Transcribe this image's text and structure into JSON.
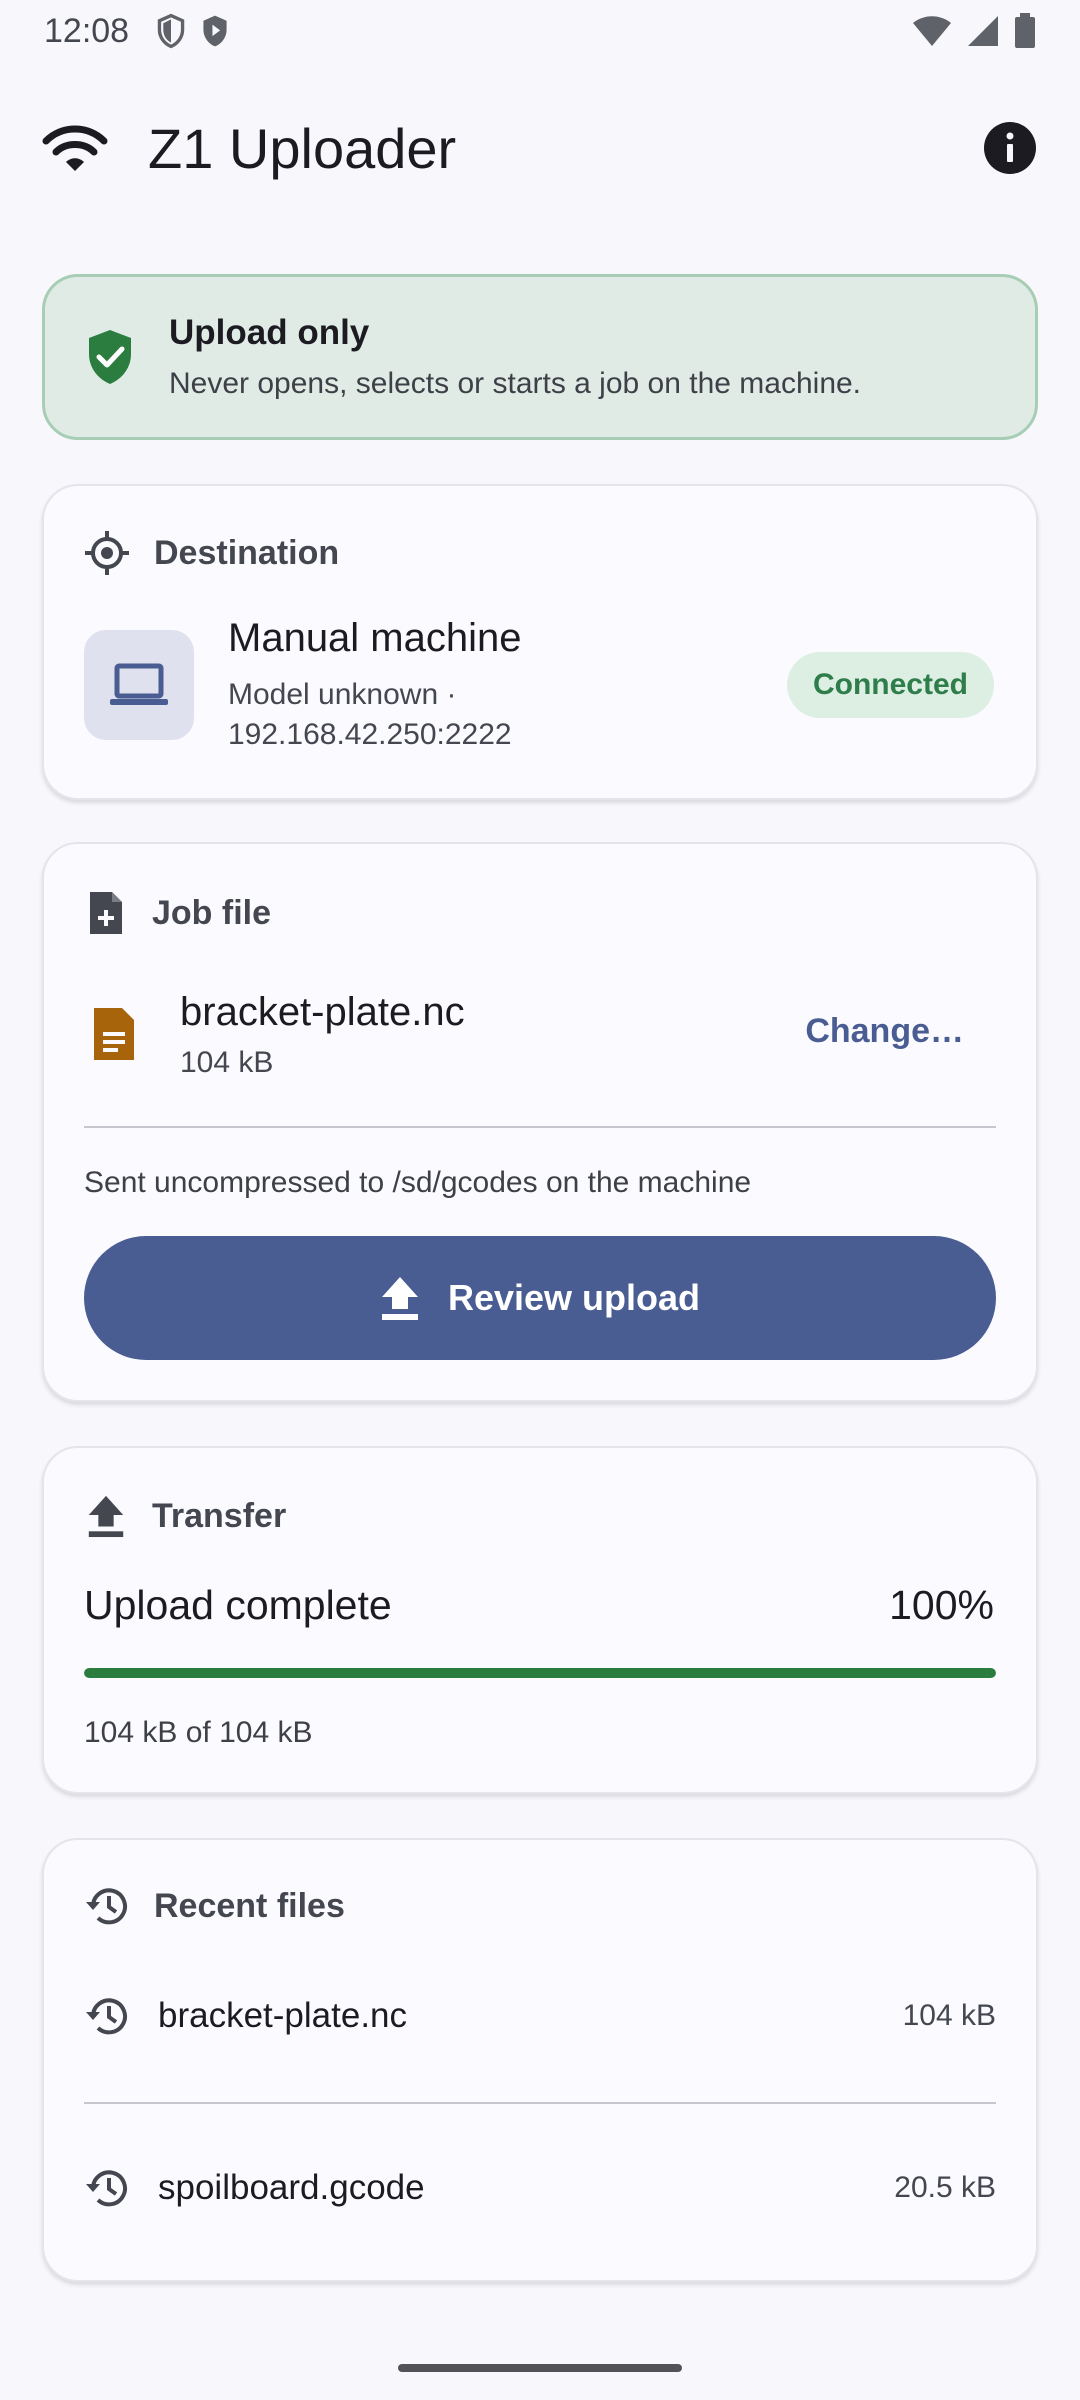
{
  "status_bar": {
    "time": "12:08"
  },
  "app_bar": {
    "title": "Z1 Uploader"
  },
  "banner": {
    "title": "Upload only",
    "subtitle": "Never opens, selects or starts a job on the machine."
  },
  "destination": {
    "header": "Destination",
    "machine_name": "Manual machine",
    "machine_detail_line1": "Model unknown ·",
    "machine_detail_line2": "192.168.42.250:2222",
    "status": "Connected"
  },
  "job_file": {
    "header": "Job file",
    "file_name": "bracket-plate.nc",
    "file_size": "104 kB",
    "change_label": "Change…",
    "note": "Sent uncompressed to /sd/gcodes on the machine",
    "review_button": "Review upload"
  },
  "transfer": {
    "header": "Transfer",
    "status": "Upload complete",
    "percent_label": "100%",
    "progress_fraction": 1.0,
    "bytes_label": "104 kB of 104 kB"
  },
  "recent_files": {
    "header": "Recent files",
    "items": [
      {
        "name": "bracket-plate.nc",
        "size": "104 kB"
      },
      {
        "name": "spoilboard.gcode",
        "size": "20.5 kB"
      }
    ]
  },
  "colors": {
    "accent": "#4a5d92",
    "success": "#2a7d3e",
    "file_icon": "#a8640a"
  },
  "icons": {
    "app_bar_leading": "wifi-icon",
    "info": "info-icon",
    "banner": "shield-check-icon",
    "destination": "target-icon",
    "machine": "laptop-icon",
    "job_file": "file-add-icon",
    "file": "document-icon",
    "transfer": "upload-icon",
    "recent": "history-icon"
  }
}
